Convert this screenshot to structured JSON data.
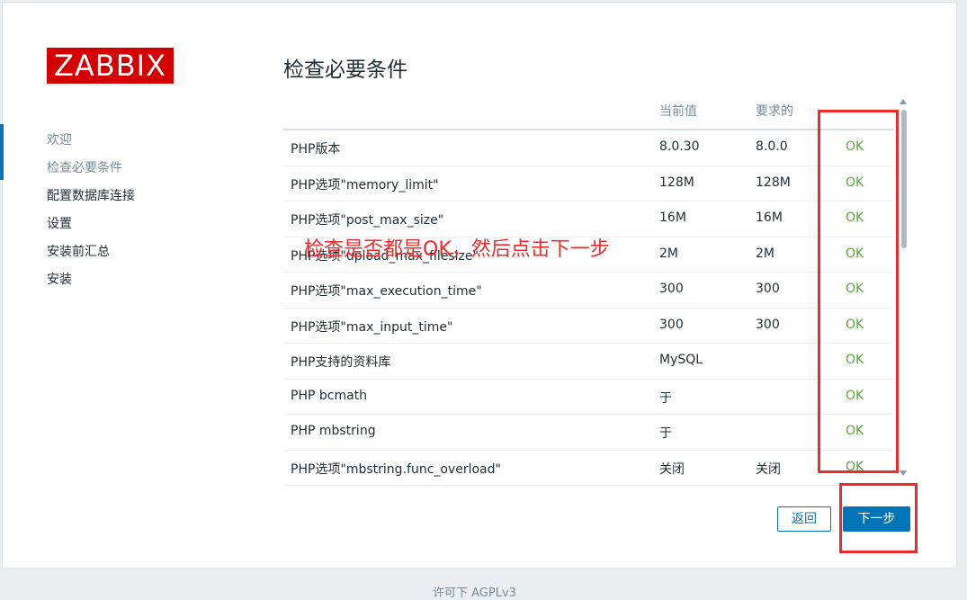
{
  "logo": {
    "text": "ZABBIX"
  },
  "sidebar": {
    "items": [
      {
        "label": "欢迎",
        "state": "done"
      },
      {
        "label": "检查必要条件",
        "state": "done"
      },
      {
        "label": "配置数据库连接",
        "state": "todo"
      },
      {
        "label": "设置",
        "state": "todo"
      },
      {
        "label": "安装前汇总",
        "state": "todo"
      },
      {
        "label": "安装",
        "state": "todo"
      }
    ]
  },
  "main": {
    "title": "检查必要条件",
    "table": {
      "headers": {
        "current": "当前值",
        "required": "要求的"
      },
      "rows": [
        {
          "name": "PHP版本",
          "current": "8.0.30",
          "required": "8.0.0",
          "status": "OK"
        },
        {
          "name": "PHP选项\"memory_limit\"",
          "current": "128M",
          "required": "128M",
          "status": "OK"
        },
        {
          "name": "PHP选项\"post_max_size\"",
          "current": "16M",
          "required": "16M",
          "status": "OK"
        },
        {
          "name": "PHP选项\"upload_max_filesize\"",
          "current": "2M",
          "required": "2M",
          "status": "OK"
        },
        {
          "name": "PHP选项\"max_execution_time\"",
          "current": "300",
          "required": "300",
          "status": "OK"
        },
        {
          "name": "PHP选项\"max_input_time\"",
          "current": "300",
          "required": "300",
          "status": "OK"
        },
        {
          "name": "PHP支持的资料库",
          "current": "MySQL",
          "required": "",
          "status": "OK"
        },
        {
          "name": "PHP bcmath",
          "current": "于",
          "required": "",
          "status": "OK"
        },
        {
          "name": "PHP mbstring",
          "current": "于",
          "required": "",
          "status": "OK"
        },
        {
          "name": "PHP选项\"mbstring.func_overload\"",
          "current": "关闭",
          "required": "关闭",
          "status": "OK"
        }
      ]
    }
  },
  "buttons": {
    "back": "返回",
    "next": "下一步"
  },
  "annotation": {
    "text": "检查是否都是OK，然后点击下一步"
  },
  "footer": {
    "text": "许可下 AGPLv3"
  },
  "colors": {
    "brand": "#d40000",
    "accent": "#0275b8",
    "ok": "#59aa3a",
    "annotation": "#ee2a2a"
  }
}
